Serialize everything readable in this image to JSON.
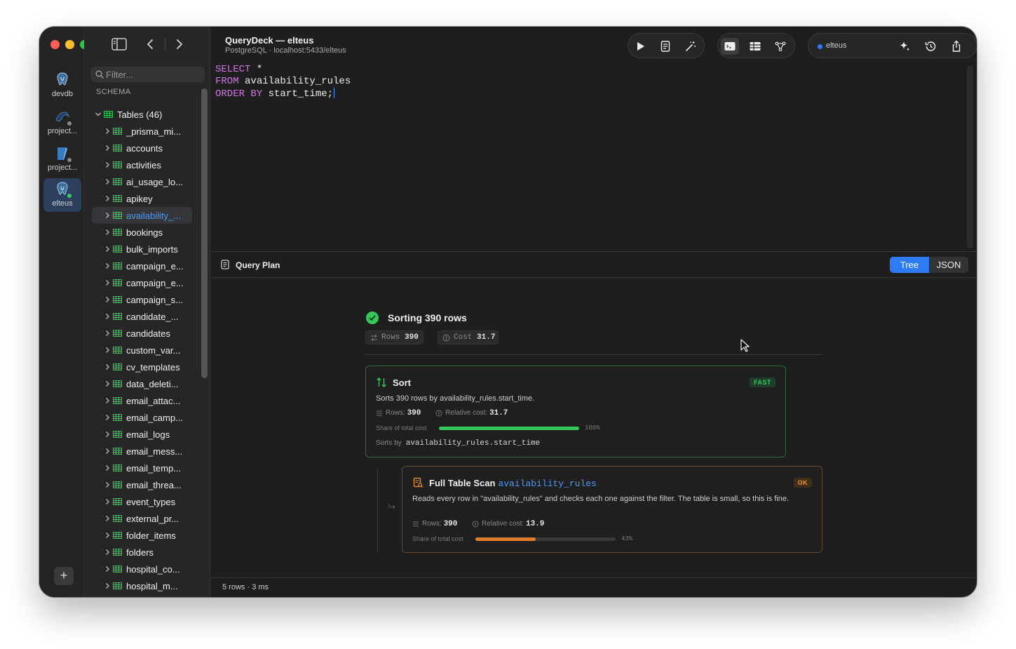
{
  "connections": [
    {
      "label": "devdb",
      "icon": "postgres-icon",
      "active": false,
      "online": false
    },
    {
      "label": "project...",
      "icon": "mysql-icon",
      "active": false,
      "online": false
    },
    {
      "label": "project...",
      "icon": "sqlite-icon",
      "active": false,
      "online": false
    },
    {
      "label": "elteus",
      "icon": "postgres-icon",
      "active": true,
      "online": true
    }
  ],
  "sidebar": {
    "filter_placeholder": "Filter...",
    "schema_label": "SCHEMA",
    "tables_group": "Tables (46)",
    "selected_table": "availability_...",
    "tables": [
      "_prisma_mi...",
      "accounts",
      "activities",
      "ai_usage_lo...",
      "apikey",
      "availability_...",
      "bookings",
      "bulk_imports",
      "campaign_e...",
      "campaign_e...",
      "campaign_s...",
      "candidate_...",
      "candidates",
      "custom_var...",
      "cv_templates",
      "data_deleti...",
      "email_attac...",
      "email_camp...",
      "email_logs",
      "email_mess...",
      "email_temp...",
      "email_threa...",
      "event_types",
      "external_pr...",
      "folder_items",
      "folders",
      "hospital_co...",
      "hospital_m..."
    ]
  },
  "header": {
    "title": "QueryDeck — elteus",
    "subtitle": "PostgreSQL · localhost:5433/elteus",
    "environment": "elteus"
  },
  "editor": {
    "lines": [
      {
        "kw": "SELECT",
        "rest": " *"
      },
      {
        "kw": "FROM",
        "rest": " availability_rules"
      },
      {
        "kw": "ORDER BY",
        "rest": " start_time;"
      }
    ]
  },
  "plan": {
    "title": "Query Plan",
    "view_tree": "Tree",
    "view_json": "JSON",
    "summary": "Sorting 390 rows",
    "chip_rows_label": "Rows",
    "chip_rows_value": "390",
    "chip_cost_label": "Cost",
    "chip_cost_value": "31.7",
    "nodes": [
      {
        "title": "Sort",
        "relation": "",
        "badge": "FAST",
        "description": "Sorts 390 rows by availability_rules.start_time.",
        "rows_label": "Rows:",
        "rows": "390",
        "cost_label": "Relative cost:",
        "cost": "31.7",
        "share_label": "Share of total cost",
        "share_pct": "100%",
        "share": 1.0,
        "color": "#34c759",
        "sort_label": "Sorts by",
        "sort_key": "availability_rules.start_time"
      },
      {
        "title": "Full Table Scan",
        "relation": "availability_rules",
        "badge": "OK",
        "description": "Reads every row in \"availability_rules\" and checks each one against the filter. The table is small, so this is fine.",
        "rows_label": "Rows:",
        "rows": "390",
        "cost_label": "Relative cost:",
        "cost": "13.9",
        "share_label": "Share of total cost",
        "share_pct": "43%",
        "share": 0.43,
        "color": "#e07d2a"
      }
    ]
  },
  "status": {
    "rows": "5 rows",
    "time": "· 3 ms"
  }
}
